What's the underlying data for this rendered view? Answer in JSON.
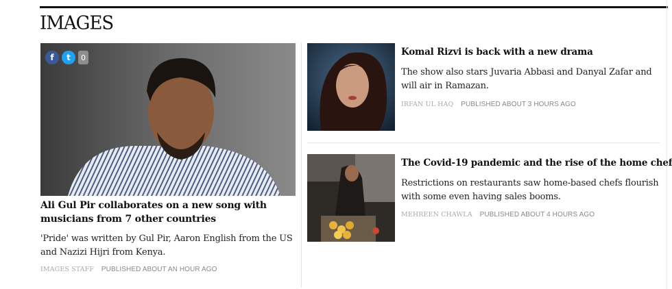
{
  "brand": {
    "logo_text": "IMAGES"
  },
  "main_story": {
    "title": "Ali Gul Pir collaborates on a new song with musicians from 7 other countries",
    "excerpt": "'Pride' was written by Gul Pir, Aaron English from the US and Nazizi Hijri from Kenya.",
    "author": "IMAGES STAFF",
    "published": "PUBLISHED ABOUT AN HOUR AGO",
    "share": {
      "facebook_icon": "f",
      "twitter_icon": "t",
      "comment_count": "0"
    }
  },
  "side_stories": [
    {
      "title": "Komal Rizvi is back with a new drama",
      "excerpt": "The show also stars Juvaria Abbasi and Danyal Zafar and will air in Ramazan.",
      "author": "IRFAN UL HAQ",
      "published": "PUBLISHED ABOUT 3 HOURS AGO"
    },
    {
      "title": "The Covid-19 pandemic and the rise of the home chef",
      "excerpt": "Restrictions on restaurants saw home-based chefs flourish with some even having sales booms.",
      "author": "MEHREEN CHAWLA",
      "published": "PUBLISHED ABOUT 4 HOURS AGO"
    }
  ]
}
